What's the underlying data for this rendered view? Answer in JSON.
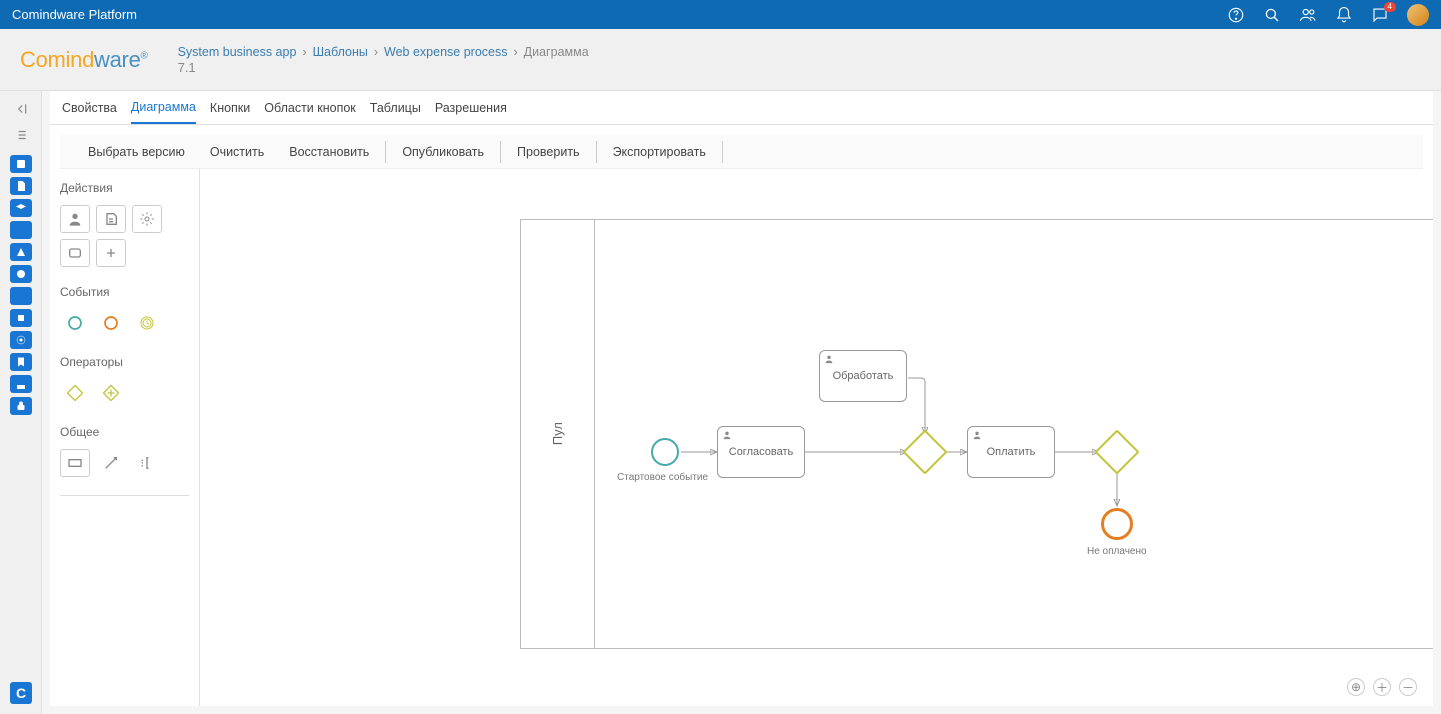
{
  "app_title": "Comindware Platform",
  "version": "7.1",
  "breadcrumb": [
    "System business app",
    "Шаблоны",
    "Web expense process",
    "Диаграмма"
  ],
  "tabs": [
    "Свойства",
    "Диаграмма",
    "Кнопки",
    "Области кнопок",
    "Таблицы",
    "Разрешения"
  ],
  "active_tab": 1,
  "toolbar": [
    "Выбрать версию",
    "Очистить",
    "Восстановить",
    "Опубликовать",
    "Проверить",
    "Экспортировать"
  ],
  "palette": {
    "actions": "Действия",
    "events": "События",
    "operators": "Операторы",
    "general": "Общее"
  },
  "pool_label": "Пул",
  "nodes": {
    "start": {
      "label": "Стартовое событие"
    },
    "task1": {
      "label": "Согласовать"
    },
    "task2": {
      "label": "Обработать"
    },
    "task3": {
      "label": "Оплатить"
    },
    "end": {
      "label": "Не оплачено"
    }
  },
  "notif_count": "4",
  "bottom_c": "C"
}
